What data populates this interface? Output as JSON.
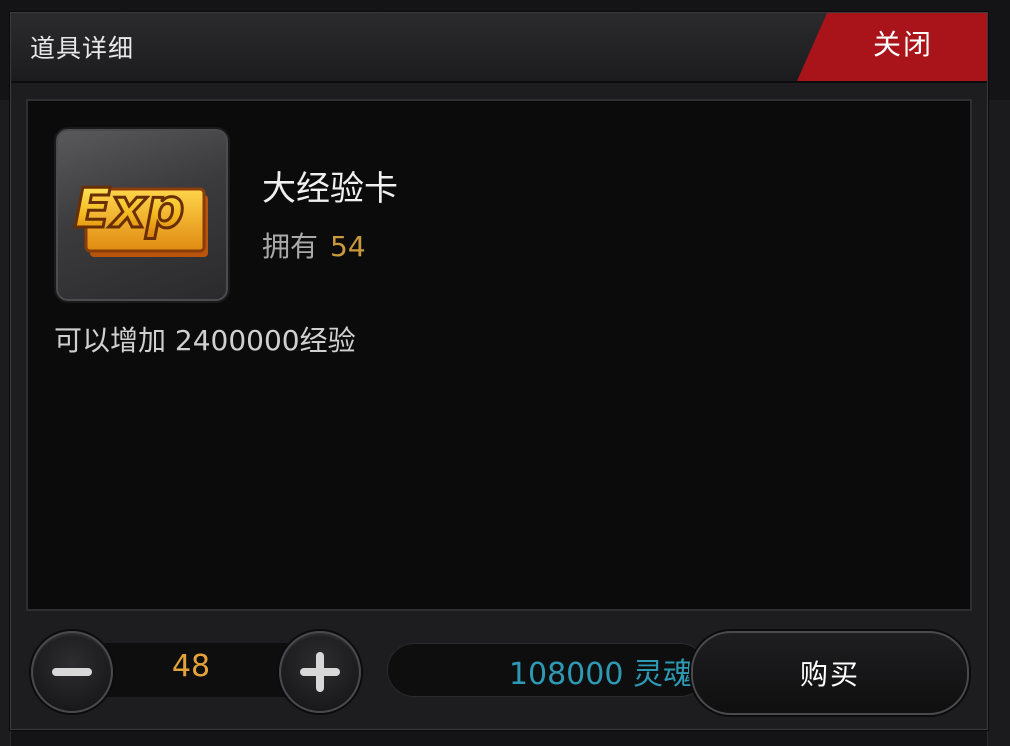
{
  "modal": {
    "title": "道具详细",
    "close_label": "关闭"
  },
  "item": {
    "icon": "exp-card-icon",
    "icon_text": "Exp",
    "name": "大经验卡",
    "owned_label": "拥有",
    "owned_count": "54",
    "description": "可以增加 2400000经验"
  },
  "purchase": {
    "quantity": "48",
    "price_value": "108000",
    "price_currency": "灵魂",
    "buy_label": "购买"
  },
  "colors": {
    "accent_red": "#a8141a",
    "quantity_orange": "#e3a33a",
    "owned_gold": "#c99a3b",
    "price_cyan": "#2e99b5"
  }
}
